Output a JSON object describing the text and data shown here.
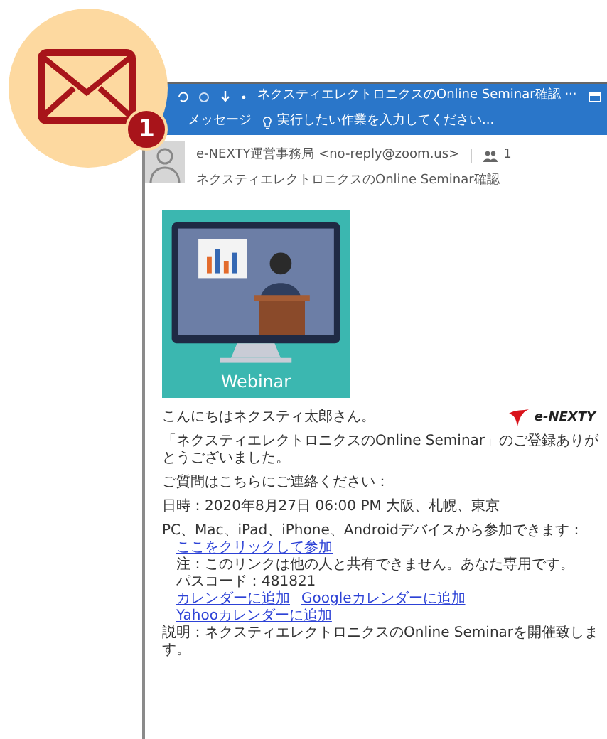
{
  "notification": {
    "count": "1"
  },
  "window": {
    "title": "ネクスティエレクトロニクスのOnline Seminar確認 ···",
    "ribbon_tab": "メッセージ",
    "tell_me": {
      "placeholder": "実行したい作業を入力してください..."
    }
  },
  "message": {
    "sender": "e-NEXTY運営事務局 <no-reply@zoom.us>",
    "recipients_count": "1",
    "subject": "ネクスティエレクトロニクスのOnline Seminar確認"
  },
  "body": {
    "banner_caption": "Webinar",
    "logo_text": "e-NEXTY",
    "greeting": "こんにちはネクスティ太郎さん。",
    "blocks": [
      [
        {
          "kind": "text",
          "text": "「ネクスティエレクトロニクスのOnline Seminar」のご登録ありがとうございました。"
        }
      ],
      [
        {
          "kind": "text",
          "text": "ご質問はこちらにご連絡ください："
        }
      ],
      [
        {
          "kind": "text",
          "text": "日時：2020年8月27日 06:00 PM 大阪、札幌、東京"
        }
      ],
      [
        {
          "kind": "text",
          "text": "PC、Mac、iPad、iPhone、Androidデバイスから参加できます：",
          "children": [
            {
              "kind": "links",
              "links": [
                "ここをクリックして参加"
              ]
            },
            {
              "kind": "text",
              "text": "注：このリンクは他の人と共有できません。あなた専用です。"
            },
            {
              "kind": "text",
              "text": "パスコード：481821"
            },
            {
              "kind": "links",
              "links": [
                "カレンダーに追加",
                "Googleカレンダーに追加",
                "Yahooカレンダーに追加"
              ]
            }
          ]
        },
        {
          "kind": "text",
          "text": "説明：ネクスティエレクトロニクスのOnline Seminarを開催致します。"
        }
      ]
    ]
  }
}
